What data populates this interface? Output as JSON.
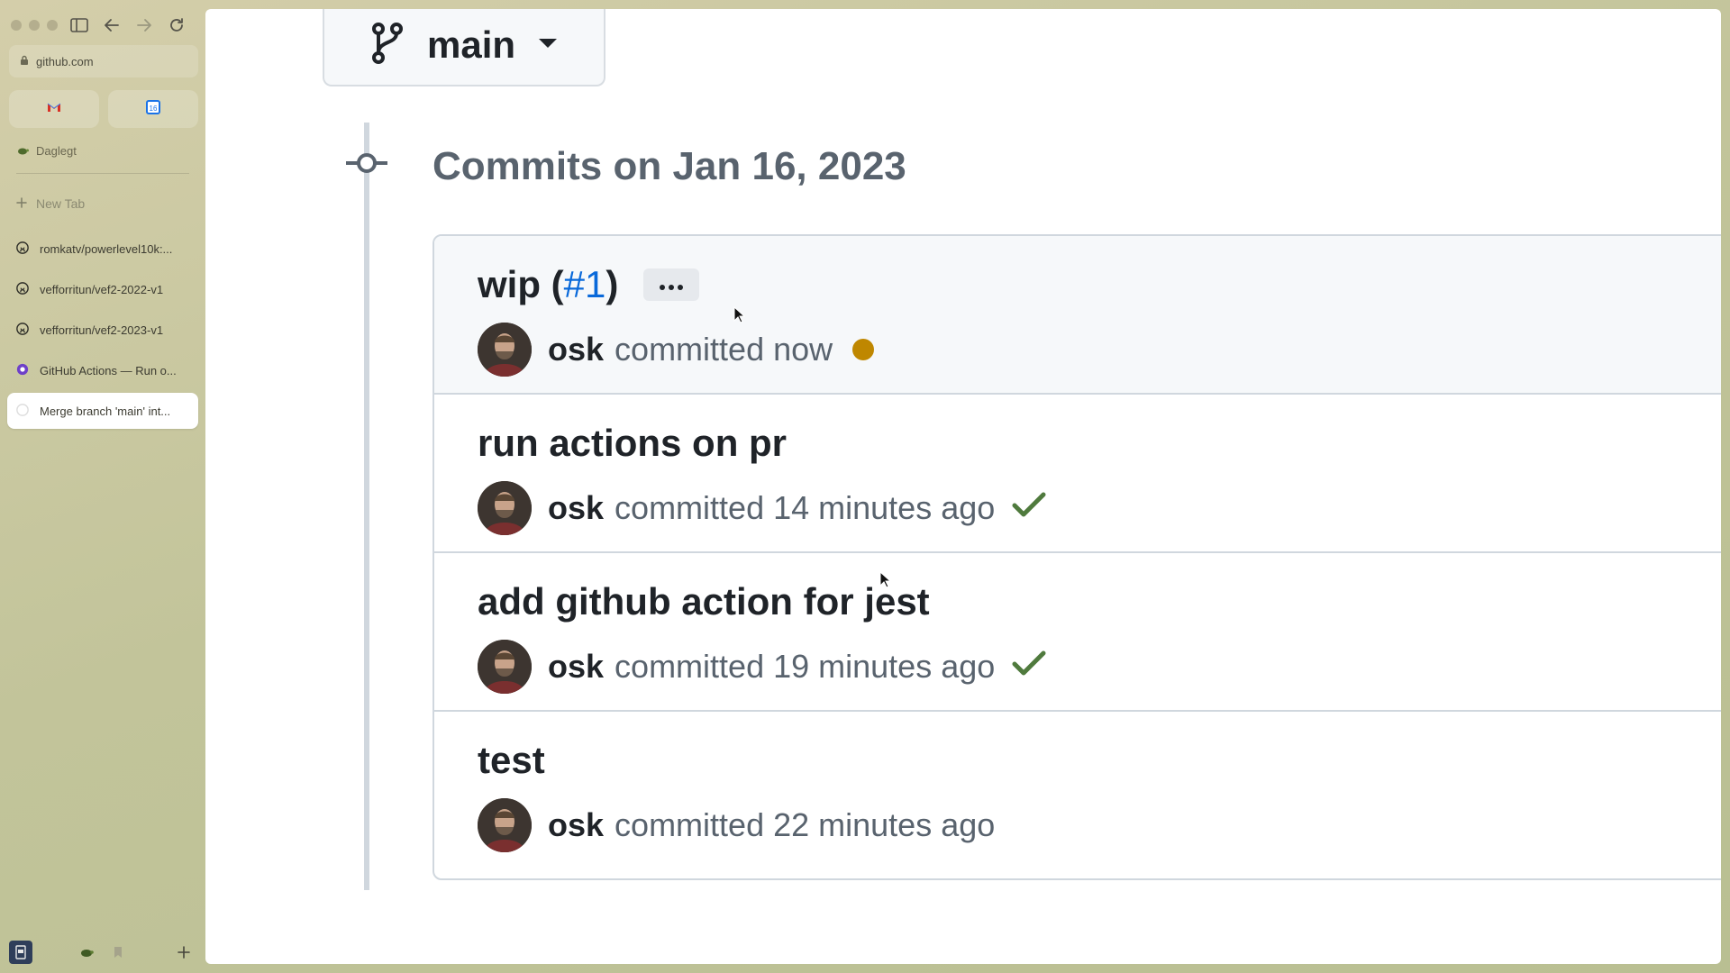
{
  "browser": {
    "url": "github.com",
    "space_name": "Daglegt",
    "new_tab_label": "New Tab",
    "tabs": [
      {
        "label": "romkatv/powerlevel10k:...",
        "icon": "github-icon",
        "active": false
      },
      {
        "label": "vefforritun/vef2-2022-v1",
        "icon": "github-icon",
        "active": false
      },
      {
        "label": "vefforritun/vef2-2023-v1",
        "icon": "github-icon",
        "active": false
      },
      {
        "label": "GitHub Actions — Run o...",
        "icon": "github-actions-icon",
        "active": false
      },
      {
        "label": "Merge branch 'main' int...",
        "icon": "github-icon",
        "active": true
      }
    ],
    "pinned": [
      "gmail-icon",
      "calendar-icon"
    ]
  },
  "page": {
    "branch": "main",
    "commits_heading": "Commits on Jan 16, 2023",
    "commits": [
      {
        "title": "wip (",
        "pr_link": "#1",
        "title_suffix": ")",
        "author": "osk",
        "time_text": "committed now",
        "status": "pending"
      },
      {
        "title": "run actions on pr",
        "author": "osk",
        "time_text": "committed 14 minutes ago",
        "status": "success"
      },
      {
        "title": "add github action for jest",
        "author": "osk",
        "time_text": "committed 19 minutes ago",
        "status": "success"
      },
      {
        "title": "test",
        "author": "osk",
        "time_text": "committed 22 minutes ago",
        "status": "none"
      }
    ]
  },
  "colors": {
    "link": "#0969da",
    "pending": "#bf8700",
    "success": "#4f7a3d",
    "text_muted": "#59636e"
  }
}
